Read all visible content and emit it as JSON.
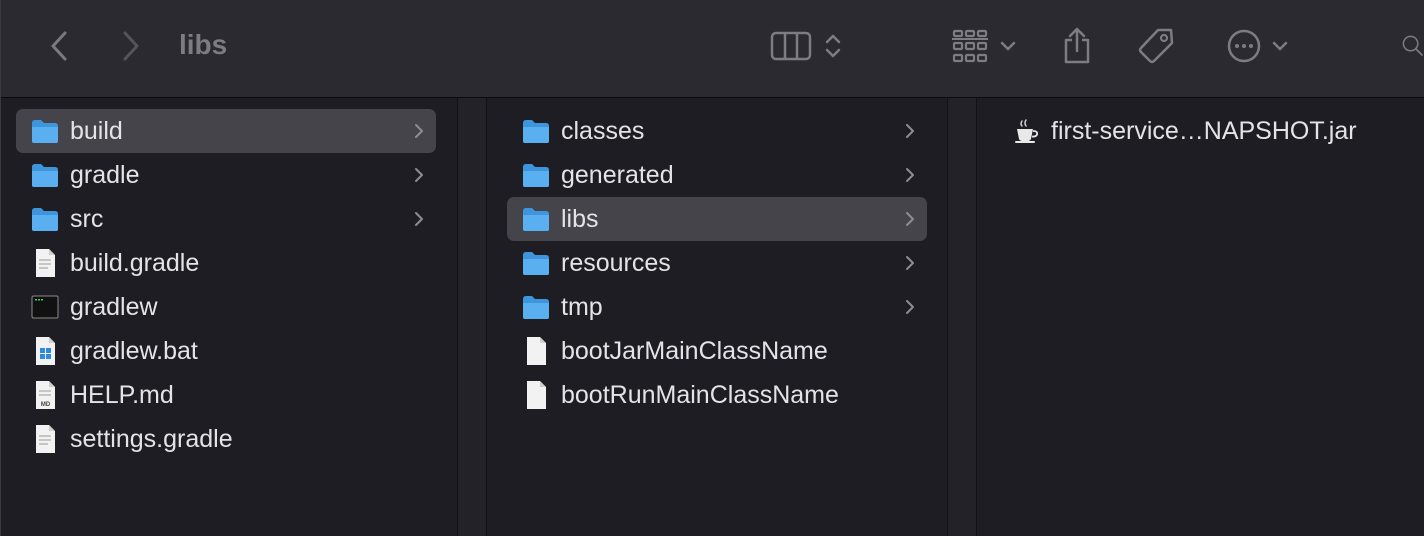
{
  "window": {
    "title": "libs"
  },
  "toolbar": {
    "icons": [
      "back-icon",
      "forward-icon",
      "column-view-icon",
      "view-switch-chevron-icon",
      "group-icon",
      "group-chevron-icon",
      "share-icon",
      "tag-icon",
      "more-icon",
      "more-chevron-icon",
      "search-icon"
    ]
  },
  "column1": {
    "items": [
      {
        "label": "build",
        "kind": "folder",
        "selected": true,
        "has_children": true
      },
      {
        "label": "gradle",
        "kind": "folder",
        "has_children": true
      },
      {
        "label": "src",
        "kind": "folder",
        "has_children": true
      },
      {
        "label": "build.gradle",
        "kind": "text-file"
      },
      {
        "label": "gradlew",
        "kind": "executable"
      },
      {
        "label": "gradlew.bat",
        "kind": "windows-file"
      },
      {
        "label": "HELP.md",
        "kind": "markdown-file",
        "badge": "MD"
      },
      {
        "label": "settings.gradle",
        "kind": "text-file"
      }
    ]
  },
  "column2": {
    "items": [
      {
        "label": "classes",
        "kind": "folder",
        "has_children": true
      },
      {
        "label": "generated",
        "kind": "folder",
        "has_children": true
      },
      {
        "label": "libs",
        "kind": "folder",
        "selected": true,
        "has_children": true
      },
      {
        "label": "resources",
        "kind": "folder",
        "has_children": true
      },
      {
        "label": "tmp",
        "kind": "folder",
        "has_children": true
      },
      {
        "label": "bootJarMainClassName",
        "kind": "blank-file"
      },
      {
        "label": "bootRunMainClassName",
        "kind": "blank-file"
      }
    ]
  },
  "column3": {
    "items": [
      {
        "label": "first-service…NAPSHOT.jar",
        "kind": "jar-file"
      }
    ]
  },
  "colors": {
    "toolbar_bg": "#2b2a31",
    "content_bg": "#1e1d24",
    "selection": "#45444b",
    "folder_blue": "#5aaff0",
    "text": "#e4e4e6",
    "dim_text": "#7d7c82"
  }
}
